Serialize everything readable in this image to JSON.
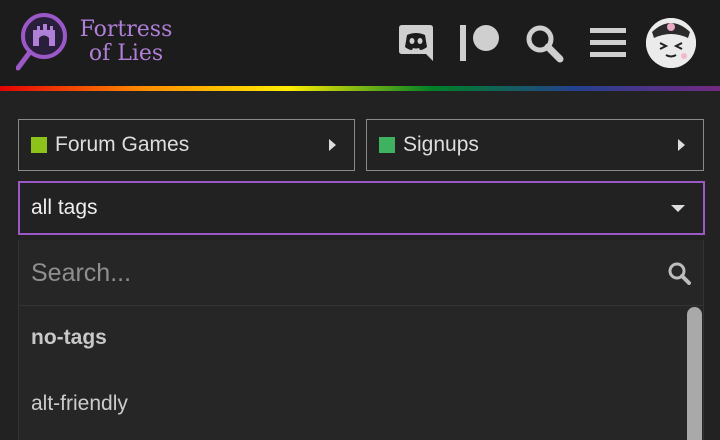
{
  "header": {
    "logo": {
      "line1": "Fortress",
      "line2": "of Lies"
    },
    "icons": [
      "discord-icon",
      "patreon-icon",
      "search-icon",
      "menu-icon"
    ],
    "colors": {
      "logo": "#b07fd8",
      "header_bg": "#1c1c1c"
    }
  },
  "filters": {
    "category": {
      "label": "Forum Games",
      "color": "#8cc21a"
    },
    "subcategory": {
      "label": "Signups",
      "color": "#3fb262"
    },
    "tags": {
      "label": "all tags",
      "border_color": "#9b59c8"
    }
  },
  "dropdown": {
    "search_placeholder": "Search...",
    "options": [
      {
        "label": "no-tags"
      },
      {
        "label": "alt-friendly"
      }
    ]
  }
}
